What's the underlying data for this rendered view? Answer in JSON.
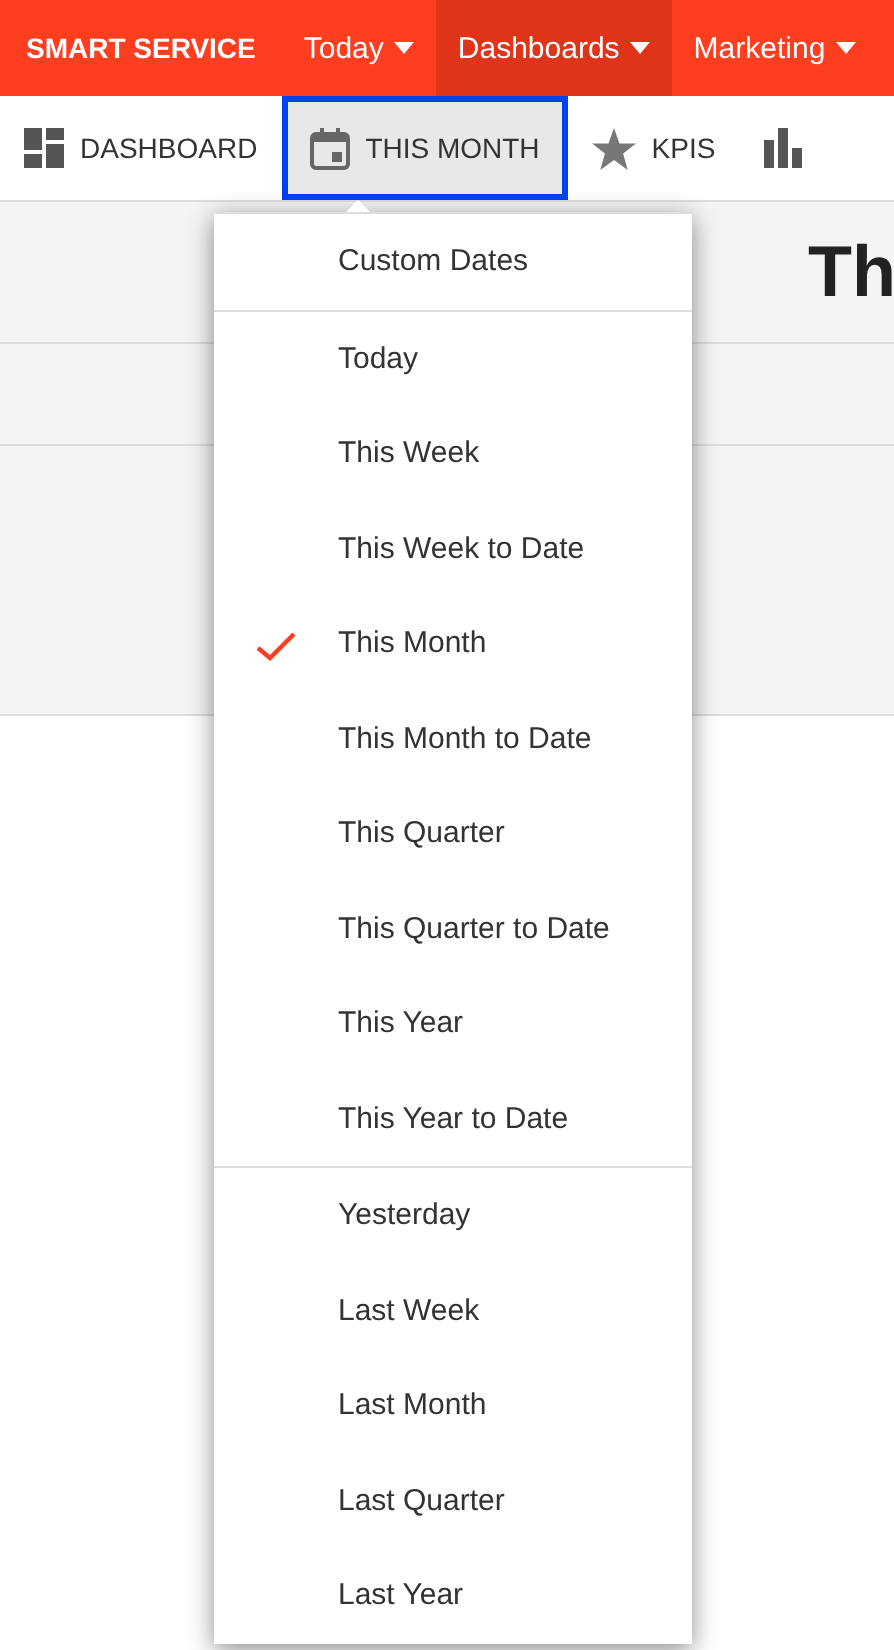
{
  "topbar": {
    "brand": "SMART SERVICE",
    "menus": [
      {
        "label": "Today",
        "selected": false
      },
      {
        "label": "Dashboards",
        "selected": true
      },
      {
        "label": "Marketing",
        "selected": false
      }
    ]
  },
  "toolbar": {
    "items": [
      {
        "kind": "grid",
        "label": "DASHBOARD",
        "selected": false
      },
      {
        "kind": "calendar",
        "label": "THIS MONTH",
        "selected": true
      },
      {
        "kind": "star",
        "label": "KPIS",
        "selected": false
      },
      {
        "kind": "chart",
        "selected": false
      }
    ]
  },
  "page": {
    "heading": "Th"
  },
  "date_menu": {
    "groups": [
      {
        "items": [
          {
            "label": "Custom Dates",
            "checked": false
          }
        ]
      },
      {
        "items": [
          {
            "label": "Today",
            "checked": false
          },
          {
            "label": "This Week",
            "checked": false
          },
          {
            "label": "This Week to Date",
            "checked": false
          },
          {
            "label": "This Month",
            "checked": true
          },
          {
            "label": "This Month to Date",
            "checked": false
          },
          {
            "label": "This Quarter",
            "checked": false
          },
          {
            "label": "This Quarter to Date",
            "checked": false
          },
          {
            "label": "This Year",
            "checked": false
          },
          {
            "label": "This Year to Date",
            "checked": false
          }
        ]
      },
      {
        "items": [
          {
            "label": "Yesterday",
            "checked": false
          },
          {
            "label": "Last Week",
            "checked": false
          },
          {
            "label": "Last Month",
            "checked": false
          },
          {
            "label": "Last Quarter",
            "checked": false
          },
          {
            "label": "Last Year",
            "checked": false
          }
        ]
      }
    ]
  }
}
